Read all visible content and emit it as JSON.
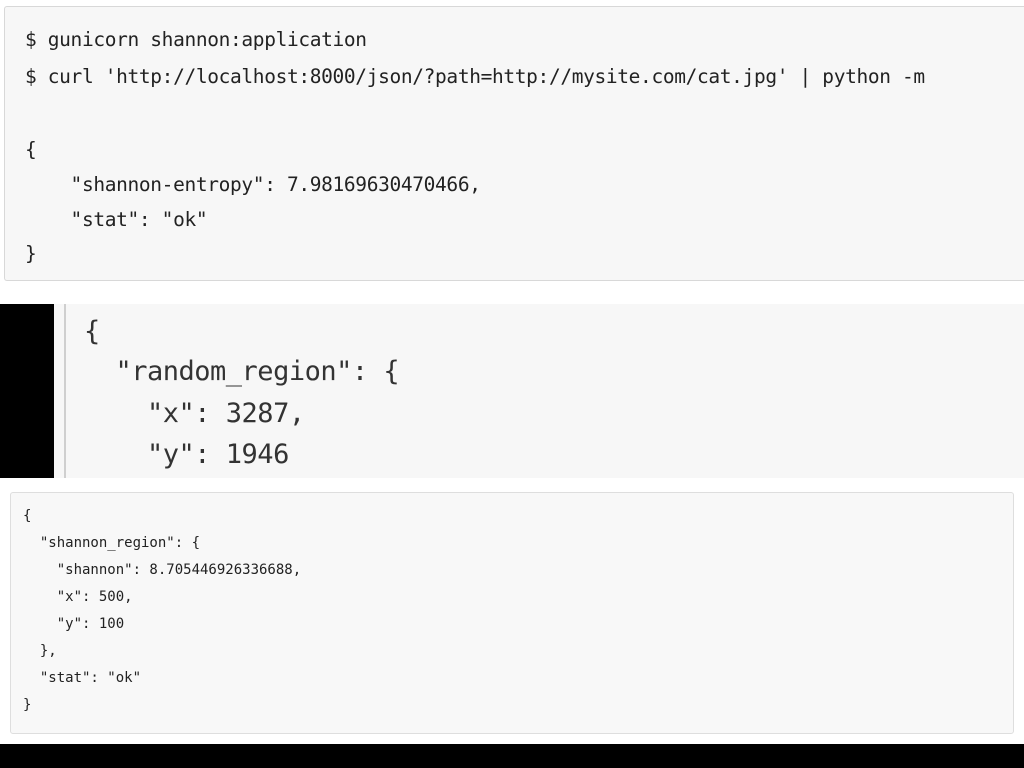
{
  "code_blocks": [
    {
      "lines": [
        "$ gunicorn shannon:application",
        "$ curl 'http://localhost:8000/json/?path=http://mysite.com/cat.jpg' | python -m",
        "",
        "{",
        "    \"shannon-entropy\": 7.98169630470466,",
        "    \"stat\": \"ok\"",
        "}"
      ]
    },
    {
      "lines": [
        "{",
        "  \"random_region\": {",
        "    \"x\": 3287,",
        "    \"y\": 1946"
      ]
    },
    {
      "lines": [
        "{",
        "  \"shannon_region\": {",
        "    \"shannon\": 8.705446926336688,",
        "    \"x\": 500,",
        "    \"y\": 100",
        "  },",
        "  \"stat\": \"ok\"",
        "}"
      ]
    }
  ]
}
